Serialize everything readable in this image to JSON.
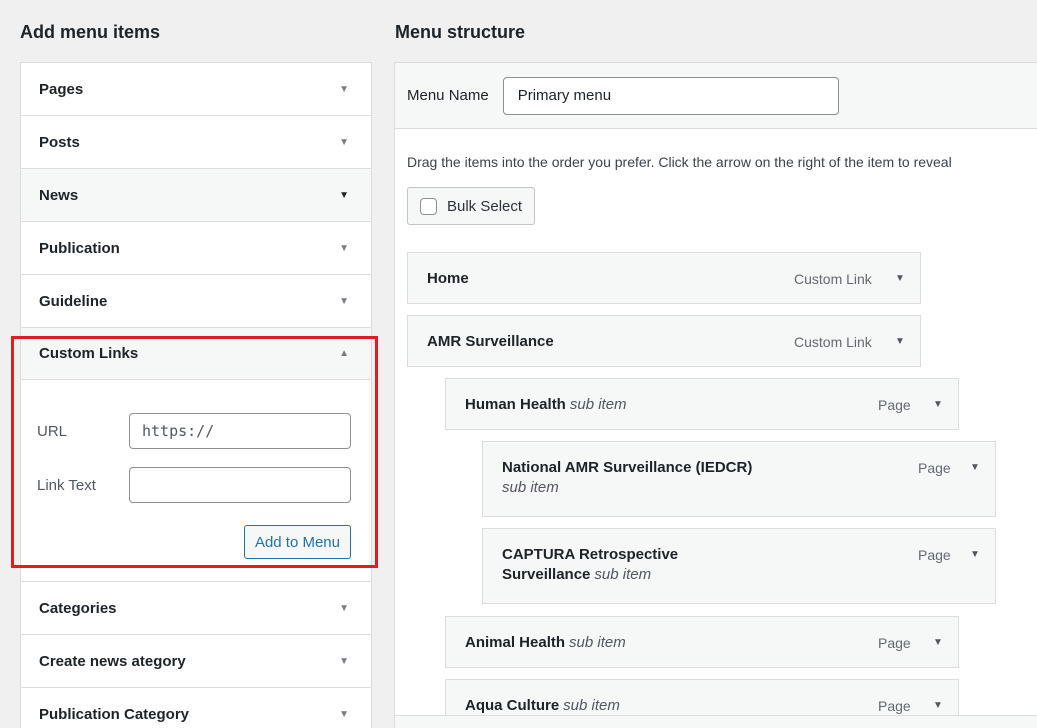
{
  "left_panel": {
    "title": "Add menu items",
    "sections": [
      {
        "label": "Pages"
      },
      {
        "label": "Posts"
      },
      {
        "label": "News"
      },
      {
        "label": "Publication"
      },
      {
        "label": "Guideline"
      }
    ],
    "custom_links": {
      "label": "Custom Links",
      "url_label": "URL",
      "url_value": "https://",
      "link_text_label": "Link Text",
      "link_text_value": "",
      "add_button": "Add to Menu"
    },
    "sections_after": [
      {
        "label": "Categories"
      },
      {
        "label": "Create news ategory"
      },
      {
        "label": "Publication Category"
      }
    ]
  },
  "right_panel": {
    "title": "Menu structure",
    "menu_name_label": "Menu Name",
    "menu_name_value": "Primary menu",
    "instructions": "Drag the items into the order you prefer. Click the arrow on the right of the item to reveal",
    "bulk_select": "Bulk Select",
    "items": [
      {
        "title": "Home",
        "sub": "",
        "type": "Custom Link"
      },
      {
        "title": "AMR Surveillance",
        "sub": "",
        "type": "Custom Link"
      },
      {
        "title": "Human Health",
        "sub": "sub item",
        "type": "Page"
      },
      {
        "title": "National AMR Surveillance (IEDCR)",
        "sub": "sub item",
        "type": "Page"
      },
      {
        "title_line1": "CAPTURA Retrospective",
        "title_line2": "Surveillance",
        "sub": "sub item",
        "type": "Page"
      },
      {
        "title": "Animal Health",
        "sub": "sub item",
        "type": "Page"
      },
      {
        "title": "Aqua Culture",
        "sub": "sub item",
        "type": "Page"
      }
    ]
  },
  "icons": {
    "collapse": "triangle-down-icon",
    "expand": "triangle-up-icon"
  },
  "colors": {
    "accent": "#2271b1",
    "highlight": "#e21c24"
  }
}
